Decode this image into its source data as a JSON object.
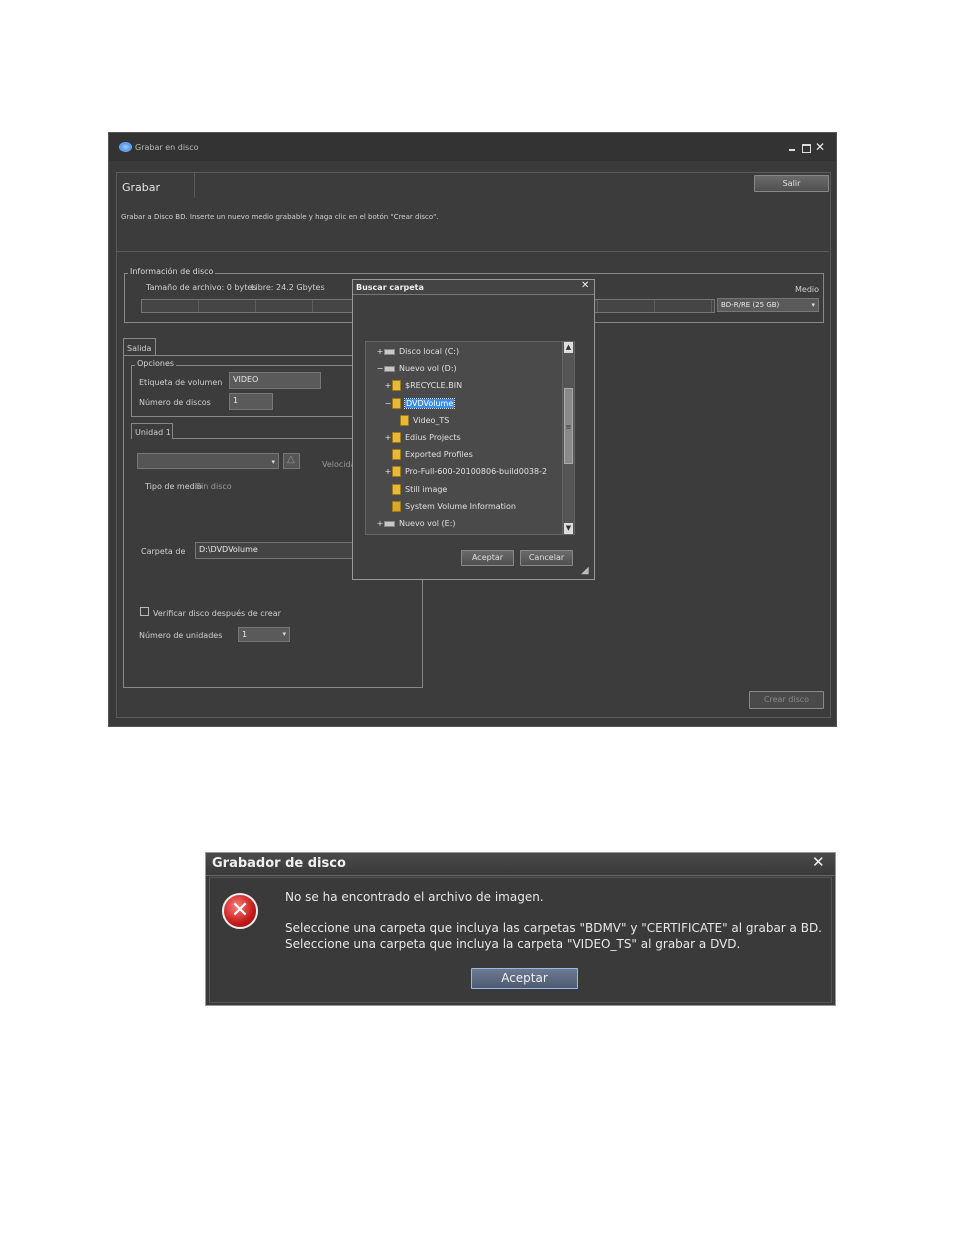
{
  "main_window": {
    "title": "Grabar en disco",
    "tab_label": "Grabar",
    "exit_label": "Salir",
    "instruction": "Grabar a Disco BD. Inserte un nuevo medio grabable y haga clic en el botón \"Crear disco\".",
    "disc_info": {
      "legend": "Información de disco",
      "file_size": "Tamaño de archivo: 0 bytes",
      "free": "Libre: 24.2 Gbytes",
      "medium_label": "Medio",
      "medium_value": "BD-R/RE (25 GB)"
    },
    "output": {
      "tab_label": "Salida",
      "options_legend": "Opciones",
      "volume_label": "Etiqueta de volumen",
      "volume_value": "VIDEO",
      "disc_count_label": "Número de discos",
      "disc_count_value": "1",
      "drive_tab": "Unidad 1",
      "speed_label": "Velocidad",
      "media_type_label": "Tipo de medio",
      "media_type_value": "Sin disco",
      "folder_label": "Carpeta de",
      "folder_value": "D:\\DVDVolume",
      "verify_label": "Verificar disco después de crear",
      "units_label": "Número de unidades",
      "units_value": "1"
    },
    "create_label": "Crear disco"
  },
  "folder_dialog": {
    "title": "Buscar carpeta",
    "tree": [
      {
        "label": "Disco local (C:)",
        "indent": 0,
        "expander": "+",
        "icon": "drive-local-icon"
      },
      {
        "label": "Nuevo vol (D:)",
        "indent": 0,
        "expander": "−",
        "icon": "drive-icon"
      },
      {
        "label": "$RECYCLE.BIN",
        "indent": 1,
        "expander": "+",
        "icon": "folder-icon"
      },
      {
        "label": "DVDVolume",
        "indent": 1,
        "expander": "−",
        "icon": "folder-icon",
        "selected": true
      },
      {
        "label": "Video_TS",
        "indent": 2,
        "expander": "",
        "icon": "folder-icon"
      },
      {
        "label": "Edius Projects",
        "indent": 1,
        "expander": "+",
        "icon": "folder-icon"
      },
      {
        "label": "Exported Profiles",
        "indent": 1,
        "expander": "",
        "icon": "folder-icon"
      },
      {
        "label": "Pro-Full-600-20100806-build0038-2",
        "indent": 1,
        "expander": "+",
        "icon": "folder-icon"
      },
      {
        "label": "Still image",
        "indent": 1,
        "expander": "",
        "icon": "folder-icon"
      },
      {
        "label": "System Volume Information",
        "indent": 1,
        "expander": "",
        "icon": "folder-lock-icon"
      },
      {
        "label": "Nuevo vol (E:)",
        "indent": 0,
        "expander": "+",
        "icon": "drive-icon"
      }
    ],
    "ok_label": "Aceptar",
    "cancel_label": "Cancelar"
  },
  "error_dialog": {
    "title": "Grabador de disco",
    "line1": "No se ha encontrado el archivo de imagen.",
    "line2": "Seleccione una carpeta que incluya las carpetas \"BDMV\" y \"CERTIFICATE\" al grabar a BD.",
    "line3": "Seleccione una carpeta que incluya la carpeta \"VIDEO_TS\" al grabar a DVD.",
    "ok_label": "Aceptar"
  }
}
